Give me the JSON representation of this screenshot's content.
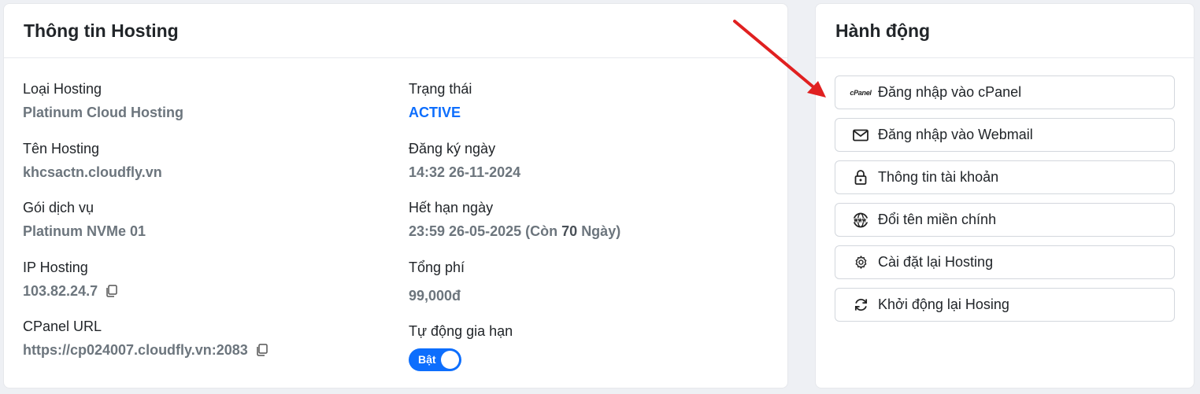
{
  "info": {
    "title": "Thông tin Hosting",
    "left": [
      {
        "label": "Loại Hosting",
        "value": "Platinum Cloud Hosting"
      },
      {
        "label": "Tên Hosting",
        "value": "khcsactn.cloudfly.vn"
      },
      {
        "label": "Gói dịch vụ",
        "value": "Platinum NVMe 01"
      },
      {
        "label": "IP Hosting",
        "value": "103.82.24.7"
      },
      {
        "label": "CPanel URL",
        "value": "https://cp024007.cloudfly.vn:2083"
      }
    ],
    "right": {
      "status_label": "Trạng thái",
      "status_value": "ACTIVE",
      "reg_label": "Đăng ký ngày",
      "reg_value": "14:32 26-11-2024",
      "exp_label": "Hết hạn ngày",
      "exp_value": "23:59 26-05-2025",
      "exp_remaining_prefix": "(Còn",
      "exp_remaining_days": "70",
      "exp_remaining_suffix": "Ngày)",
      "fee_label": "Tổng phí",
      "fee_value": "99,000đ",
      "autorenew_label": "Tự động gia hạn",
      "autorenew_toggle": "Bật"
    }
  },
  "actions": {
    "title": "Hành động",
    "cpanel_logo": "cPanel",
    "buttons": [
      {
        "label": "Đăng nhập vào cPanel",
        "icon": "cpanel-icon"
      },
      {
        "label": "Đăng nhập vào Webmail",
        "icon": "mail-icon"
      },
      {
        "label": "Thông tin tài khoản",
        "icon": "lock-icon"
      },
      {
        "label": "Đổi tên miền chính",
        "icon": "www-globe-icon"
      },
      {
        "label": "Cài đặt lại Hosting",
        "icon": "gear-icon"
      },
      {
        "label": "Khởi động lại Hosing",
        "icon": "refresh-icon"
      }
    ]
  },
  "colors": {
    "accent": "#0d6efd",
    "annotation_arrow": "#e02020"
  }
}
